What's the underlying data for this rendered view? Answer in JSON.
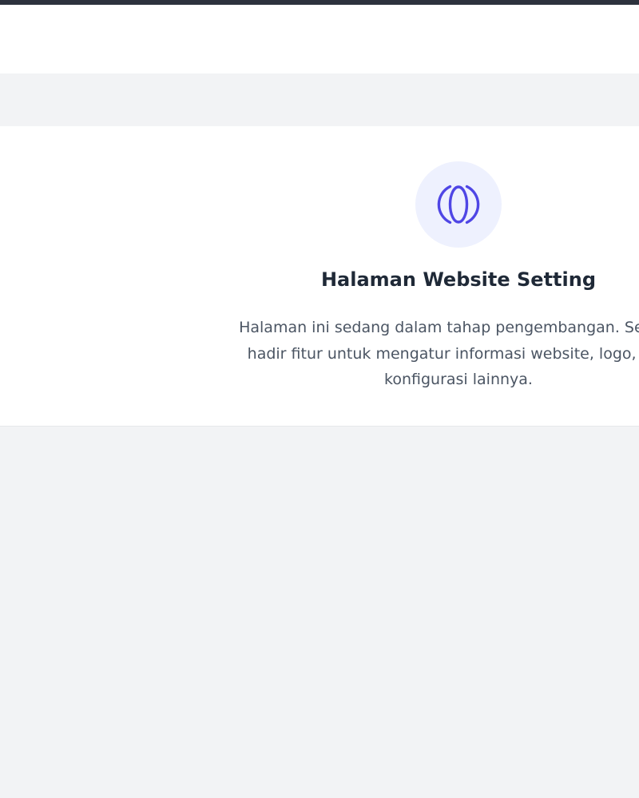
{
  "page": {
    "title": "Halaman Website Setting",
    "description": "Halaman ini sedang dalam tahap pengembangan. Segera hadir fitur untuk mengatur informasi website, logo, dan konfigurasi lainnya.",
    "icon": "globe-icon"
  },
  "colors": {
    "accent": "#4f46e5",
    "icon_bg": "#eef1fe",
    "topbar": "#2d323d",
    "background": "#f2f3f5"
  }
}
